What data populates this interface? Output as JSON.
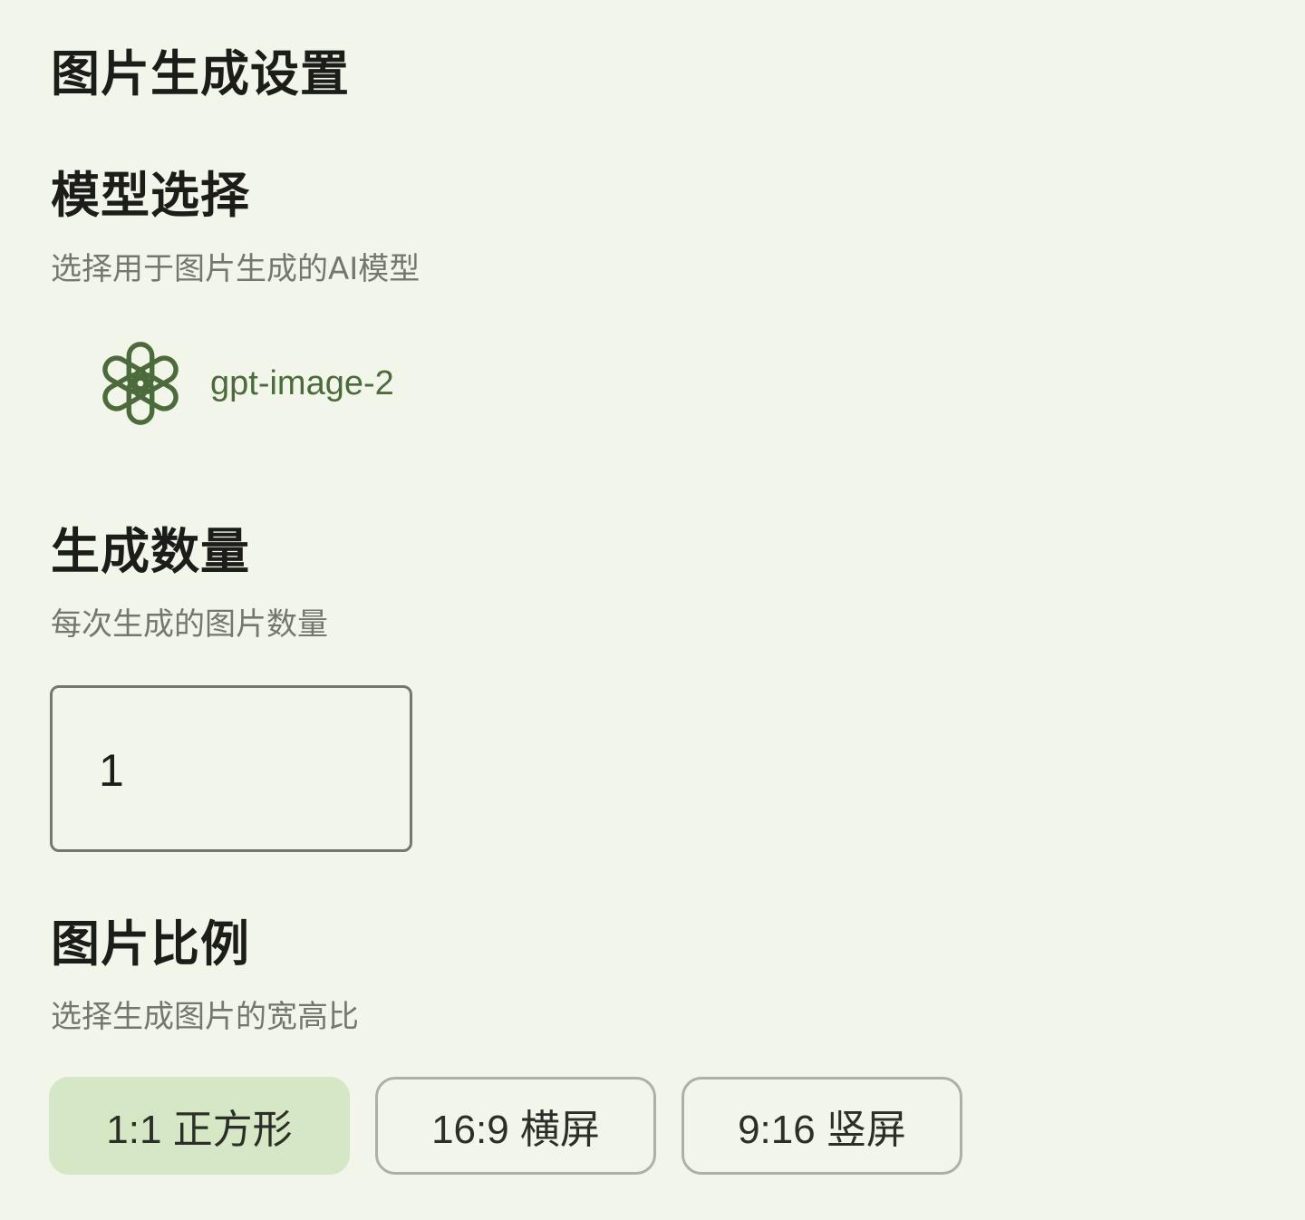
{
  "page": {
    "title": "图片生成设置"
  },
  "model_section": {
    "title": "模型选择",
    "description": "选择用于图片生成的AI模型",
    "selected_model": {
      "name": "gpt-image-2",
      "icon": "openai-logo-icon"
    }
  },
  "count_section": {
    "title": "生成数量",
    "description": "每次生成的图片数量",
    "value": "1"
  },
  "ratio_section": {
    "title": "图片比例",
    "description": "选择生成图片的宽高比",
    "options": [
      {
        "label": "1:1 正方形",
        "selected": true
      },
      {
        "label": "16:9 横屏",
        "selected": false
      },
      {
        "label": "9:16 竖屏",
        "selected": false
      }
    ]
  },
  "colors": {
    "background": "#f1f5ea",
    "accent": "#4b6b3a",
    "selected_chip": "#d5e7c5",
    "muted_text": "#73776d"
  }
}
